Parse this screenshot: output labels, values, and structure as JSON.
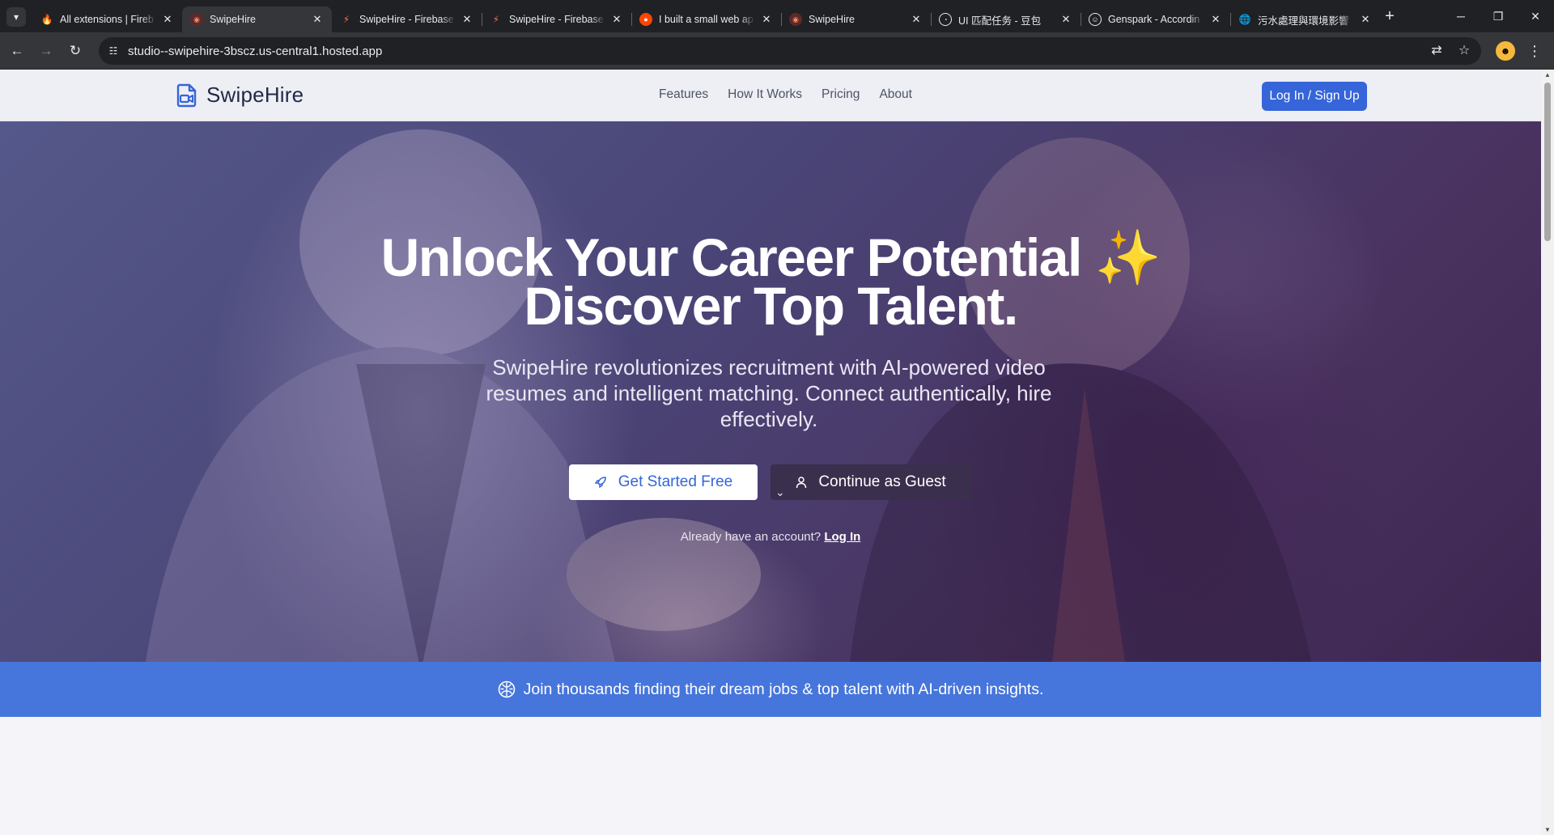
{
  "browser": {
    "tabs": [
      {
        "title": "All extensions | Fireb",
        "icon": "firebase-icon",
        "active": false
      },
      {
        "title": "SwipeHire",
        "icon": "studio-icon",
        "active": true
      },
      {
        "title": "SwipeHire - Firebase",
        "icon": "firebase-icon",
        "active": false
      },
      {
        "title": "SwipeHire - Firebase",
        "icon": "firebase-icon",
        "active": false
      },
      {
        "title": "I built a small web ap",
        "icon": "reddit-icon",
        "active": false
      },
      {
        "title": "SwipeHire",
        "icon": "studio-icon",
        "active": false
      },
      {
        "title": "UI 匹配任务 - 豆包",
        "icon": "doubao-icon",
        "active": false
      },
      {
        "title": "Genspark - Accordin",
        "icon": "genspark-icon",
        "active": false
      },
      {
        "title": "污水處理與環境影響",
        "icon": "globe-icon",
        "active": false
      }
    ],
    "url": "studio--swipehire-3bscz.us-central1.hosted.app"
  },
  "site": {
    "brand": "SwipeHire",
    "nav": [
      "Features",
      "How It Works",
      "Pricing",
      "About"
    ],
    "login_button": "Log In / Sign Up"
  },
  "hero": {
    "headline_line1": "Unlock Your Career Potential",
    "sparkle": "✨",
    "headline_line2": "Discover Top Talent.",
    "subhead": "SwipeHire revolutionizes recruitment with AI-powered video resumes and intelligent matching. Connect authentically, hire effectively.",
    "primary_cta": "Get Started Free",
    "secondary_cta": "Continue as Guest",
    "already_text": "Already have an account?",
    "login_link": "Log In"
  },
  "banner": {
    "text": "Join thousands finding their dream jobs & top talent with AI-driven insights."
  },
  "colors": {
    "brand_blue": "#3565d8",
    "banner_blue": "#4675dc",
    "chrome_dark": "#202124"
  }
}
